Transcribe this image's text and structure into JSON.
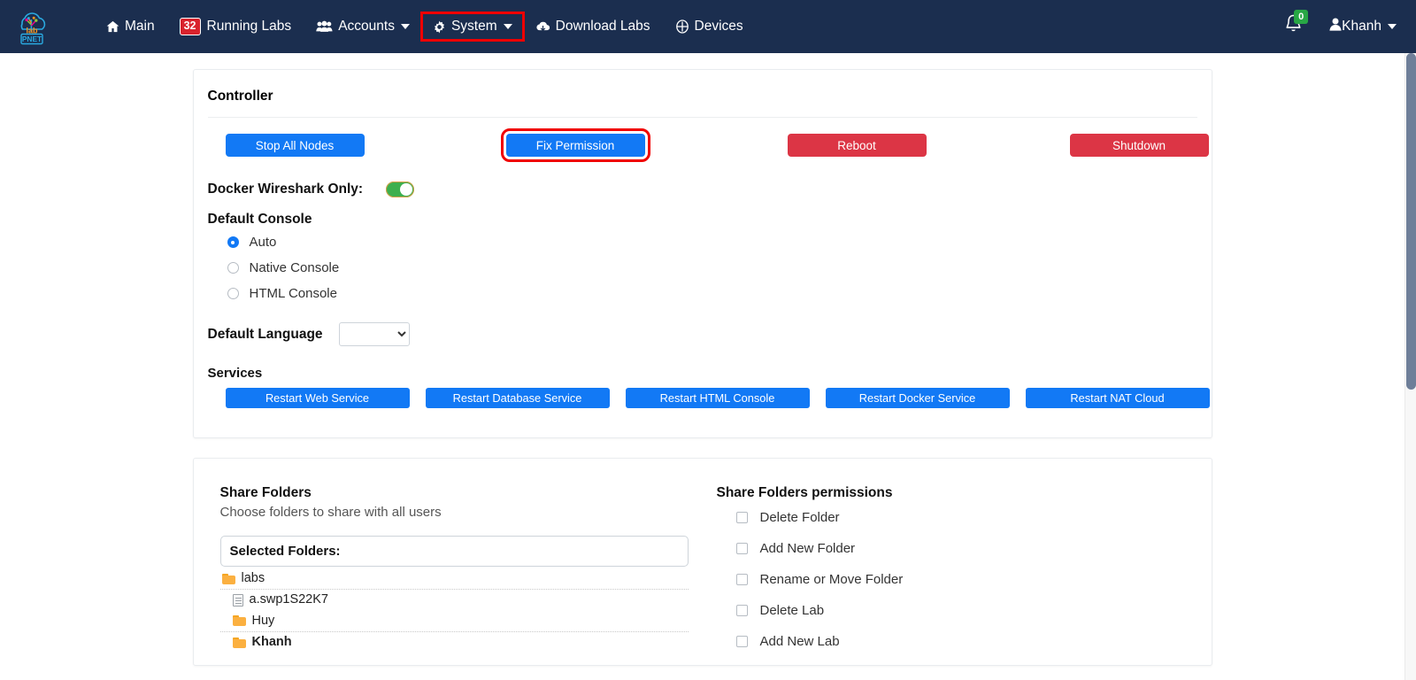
{
  "navbar": {
    "brand": {
      "icon": "pnet-cloud-tree-logo",
      "text": "PNET"
    },
    "items": [
      {
        "id": "main",
        "label": "Main",
        "icon": "home-icon",
        "badge": null,
        "caret": false,
        "highlighted": false
      },
      {
        "id": "running-labs",
        "label": "Running Labs",
        "icon": "badge-count",
        "badge": "32",
        "caret": false,
        "highlighted": false
      },
      {
        "id": "accounts",
        "label": "Accounts",
        "icon": "users-icon",
        "badge": null,
        "caret": true,
        "highlighted": false
      },
      {
        "id": "system",
        "label": "System",
        "icon": "gear-icon",
        "badge": null,
        "caret": true,
        "highlighted": true
      },
      {
        "id": "download-labs",
        "label": "Download Labs",
        "icon": "cloud-download-icon",
        "badge": null,
        "caret": false,
        "highlighted": false
      },
      {
        "id": "devices",
        "label": "Devices",
        "icon": "devices-plus-icon",
        "badge": null,
        "caret": false,
        "highlighted": false
      }
    ],
    "notifications": {
      "icon": "bell-icon",
      "count": "0"
    },
    "user": {
      "icon": "user-icon",
      "name": "Khanh",
      "caret": true
    }
  },
  "controller": {
    "title": "Controller",
    "buttons": [
      {
        "id": "stop-all-nodes",
        "label": "Stop All Nodes",
        "style": "primary",
        "highlighted": false
      },
      {
        "id": "fix-permission",
        "label": "Fix Permission",
        "style": "primary",
        "highlighted": true
      },
      {
        "id": "reboot",
        "label": "Reboot",
        "style": "danger",
        "highlighted": false
      },
      {
        "id": "shutdown",
        "label": "Shutdown",
        "style": "danger",
        "highlighted": false
      }
    ],
    "docker_wireshark": {
      "label": "Docker Wireshark Only:",
      "enabled": true
    },
    "default_console": {
      "label": "Default Console",
      "options": [
        {
          "id": "auto",
          "label": "Auto",
          "selected": true
        },
        {
          "id": "native-console",
          "label": "Native Console",
          "selected": false
        },
        {
          "id": "html-console",
          "label": "HTML Console",
          "selected": false
        }
      ]
    },
    "default_language": {
      "label": "Default Language",
      "value": ""
    },
    "services": {
      "label": "Services",
      "buttons": [
        {
          "id": "restart-web-service",
          "label": "Restart Web Service"
        },
        {
          "id": "restart-database-service",
          "label": "Restart Database Service"
        },
        {
          "id": "restart-html-console",
          "label": "Restart HTML Console"
        },
        {
          "id": "restart-docker-service",
          "label": "Restart Docker Service"
        },
        {
          "id": "restart-nat-cloud",
          "label": "Restart NAT Cloud"
        }
      ]
    }
  },
  "share_folders": {
    "title": "Share Folders",
    "subtitle": "Choose folders to share with all users",
    "selected_label": "Selected Folders:",
    "tree": [
      {
        "name": "labs",
        "type": "folder",
        "level": 1,
        "bold": false
      },
      {
        "name": "a.swp1S22K7",
        "type": "file",
        "level": 2,
        "bold": false
      },
      {
        "name": "Huy",
        "type": "folder",
        "level": 2,
        "bold": false
      },
      {
        "name": "Khanh",
        "type": "folder",
        "level": 2,
        "bold": true
      }
    ],
    "permissions_title": "Share Folders permissions",
    "permissions": [
      {
        "id": "delete-folder",
        "label": "Delete Folder",
        "checked": false
      },
      {
        "id": "add-new-folder",
        "label": "Add New Folder",
        "checked": false
      },
      {
        "id": "rename-or-move-folder",
        "label": "Rename or Move Folder",
        "checked": false
      },
      {
        "id": "delete-lab",
        "label": "Delete Lab",
        "checked": false
      },
      {
        "id": "add-new-lab",
        "label": "Add New Lab",
        "checked": false
      }
    ]
  },
  "colors": {
    "navbar_bg": "#1b2e4f",
    "primary": "#1279f5",
    "danger": "#dc3545",
    "highlight": "#f00000",
    "toggle_on": "#3daf4e",
    "badge_red": "#d9232d",
    "badge_green": "#28a745",
    "folder": "#fbb040"
  }
}
